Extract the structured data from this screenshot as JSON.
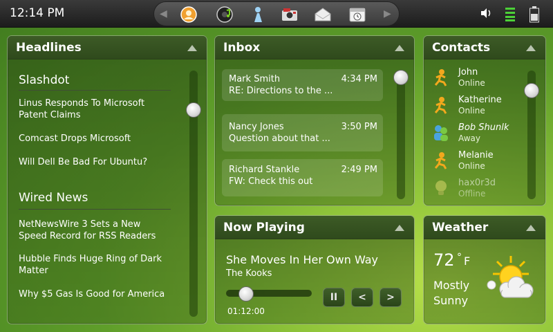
{
  "topbar": {
    "clock": "12:14 PM",
    "dock_icons": [
      "browser-icon",
      "music-icon",
      "chat-icon",
      "photos-icon",
      "mail-icon",
      "calendar-icon"
    ],
    "status_icons": [
      "volume-icon",
      "signal-icon",
      "battery-icon"
    ]
  },
  "headlines": {
    "title": "Headlines",
    "sections": [
      {
        "name": "Slashdot",
        "items": [
          "Linus Responds To Microsoft Patent Claims",
          "Comcast Drops Microsoft",
          "Will Dell Be Bad For Ubuntu?"
        ]
      },
      {
        "name": "Wired News",
        "items": [
          "NetNewsWire 3 Sets a New Speed Record for RSS Readers",
          "Hubble Finds Huge Ring of Dark Matter",
          "Why $5 Gas Is Good for America"
        ]
      }
    ]
  },
  "inbox": {
    "title": "Inbox",
    "messages": [
      {
        "from": "Mark Smith",
        "time": "4:34 PM",
        "subject": "RE: Directions to the ..."
      },
      {
        "from": "Nancy Jones",
        "time": "3:50 PM",
        "subject": "Question about that ..."
      },
      {
        "from": "Richard Stankle",
        "time": "2:49 PM",
        "subject": "FW: Check this out"
      }
    ]
  },
  "contacts": {
    "title": "Contacts",
    "people": [
      {
        "name": "John",
        "status": "Online"
      },
      {
        "name": "Katherine",
        "status": "Online"
      },
      {
        "name": "Bob Shunlk",
        "status": "Away"
      },
      {
        "name": "Melanie",
        "status": "Online"
      },
      {
        "name": "hax0r3d",
        "status": "Offline"
      }
    ]
  },
  "now_playing": {
    "title": "Now Playing",
    "track": "She Moves In Her Own Way",
    "artist": "The Kooks",
    "elapsed": "01:12:00",
    "pause_label": "II",
    "prev_label": "<",
    "next_label": ">"
  },
  "weather": {
    "title": "Weather",
    "temperature": "72",
    "degree": "°",
    "unit": "F",
    "condition": "Mostly Sunny"
  },
  "colors": {
    "background": "#5f9e2a",
    "header": "#2f4a1c",
    "online_icon": "#f2a81d",
    "away_icon": "#4aa3df",
    "offline_icon": "#c9c96a"
  }
}
